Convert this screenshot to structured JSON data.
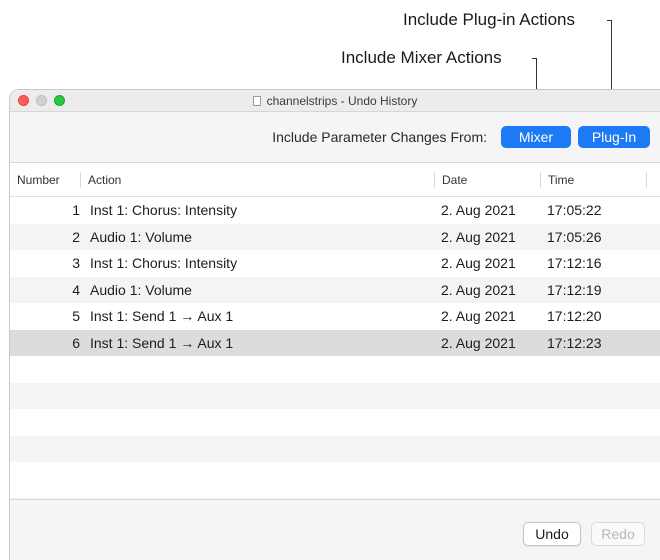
{
  "callouts": {
    "plugin_actions": "Include Plug-in Actions",
    "mixer_actions": "Include Mixer Actions"
  },
  "window": {
    "title": "channelstrips - Undo History"
  },
  "toolbar": {
    "label": "Include Parameter Changes From:",
    "mixer_button": "Mixer",
    "plugin_button": "Plug-In"
  },
  "table": {
    "columns": [
      "Number",
      "Action",
      "Date",
      "Time"
    ],
    "rows": [
      {
        "number": "1",
        "action": "Inst 1: Chorus: Intensity",
        "date": "2. Aug 2021",
        "time": "17:05:22"
      },
      {
        "number": "2",
        "action": "Audio 1: Volume",
        "date": "2. Aug 2021",
        "time": "17:05:26"
      },
      {
        "number": "3",
        "action": "Inst 1: Chorus: Intensity",
        "date": "2. Aug 2021",
        "time": "17:12:16"
      },
      {
        "number": "4",
        "action": "Audio 1: Volume",
        "date": "2. Aug 2021",
        "time": "17:12:19"
      },
      {
        "number": "5",
        "action": "Inst 1: Send 1 → Aux 1",
        "date": "2. Aug 2021",
        "time": "17:12:20"
      },
      {
        "number": "6",
        "action": "Inst 1: Send 1 → Aux 1",
        "date": "2. Aug 2021",
        "time": "17:12:23"
      }
    ],
    "selected_row": 6
  },
  "footer": {
    "undo_label": "Undo",
    "redo_label": "Redo"
  },
  "colors": {
    "accent": "#1c7bf4",
    "selected_row": "#dcdcdc"
  }
}
